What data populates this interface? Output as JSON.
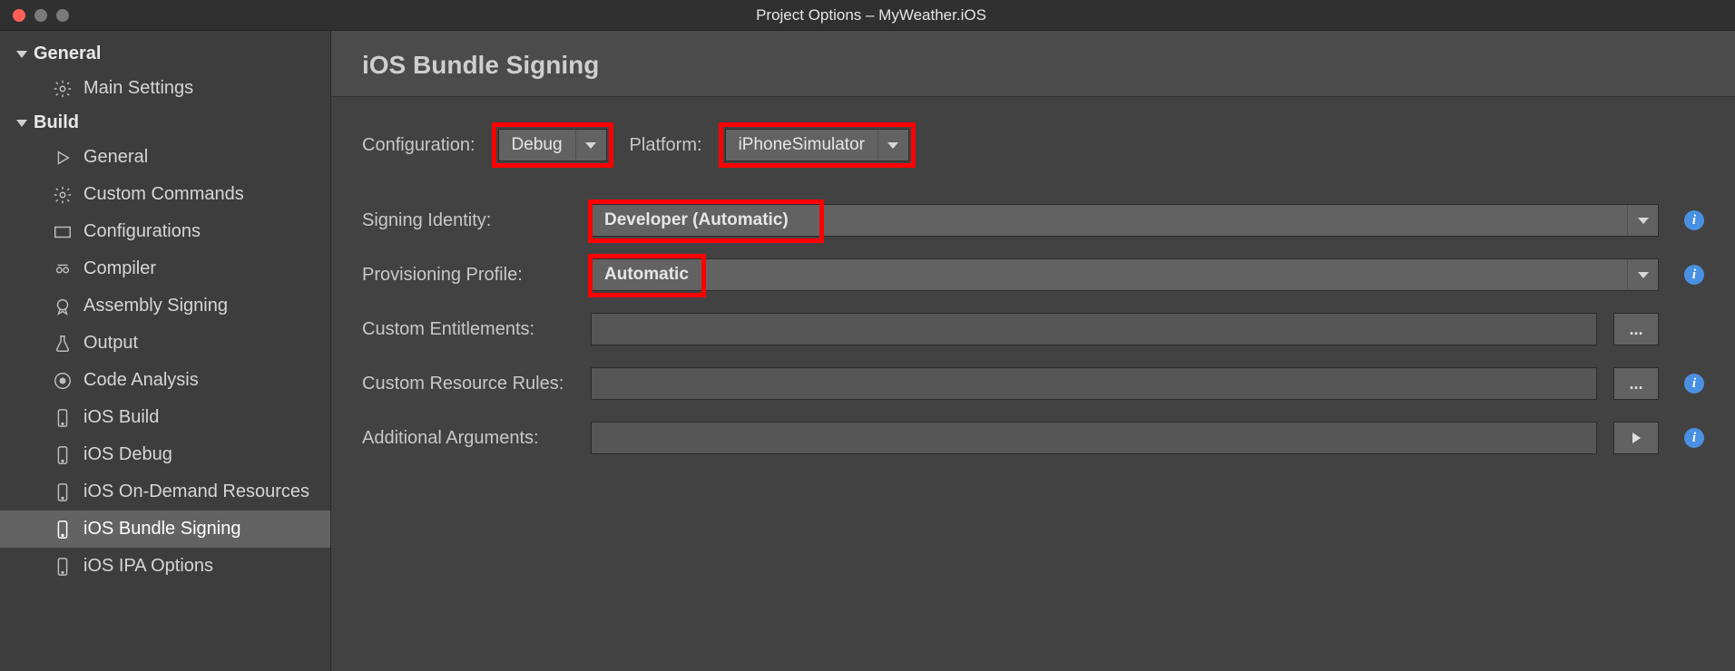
{
  "window": {
    "title": "Project Options – MyWeather.iOS"
  },
  "sidebar": {
    "categories": [
      {
        "label": "General",
        "items": [
          {
            "label": "Main Settings",
            "icon": "gear"
          }
        ]
      },
      {
        "label": "Build",
        "items": [
          {
            "label": "General",
            "icon": "play"
          },
          {
            "label": "Custom Commands",
            "icon": "gear"
          },
          {
            "label": "Configurations",
            "icon": "rect"
          },
          {
            "label": "Compiler",
            "icon": "compiler"
          },
          {
            "label": "Assembly Signing",
            "icon": "badge"
          },
          {
            "label": "Output",
            "icon": "flask"
          },
          {
            "label": "Code Analysis",
            "icon": "target"
          },
          {
            "label": "iOS Build",
            "icon": "phone"
          },
          {
            "label": "iOS Debug",
            "icon": "phone"
          },
          {
            "label": "iOS On-Demand Resources",
            "icon": "phone"
          },
          {
            "label": "iOS Bundle Signing",
            "icon": "phone",
            "selected": true
          },
          {
            "label": "iOS IPA Options",
            "icon": "phone"
          }
        ]
      }
    ]
  },
  "panel": {
    "title": "iOS Bundle Signing",
    "top": {
      "config_label": "Configuration:",
      "config_value": "Debug",
      "platform_label": "Platform:",
      "platform_value": "iPhoneSimulator"
    },
    "fields": {
      "signing_label": "Signing Identity:",
      "signing_value": "Developer (Automatic)",
      "provisioning_label": "Provisioning Profile:",
      "provisioning_value": "Automatic",
      "entitlements_label": "Custom Entitlements:",
      "entitlements_value": "",
      "resource_label": "Custom Resource Rules:",
      "resource_value": "",
      "args_label": "Additional Arguments:",
      "args_value": "",
      "browse": "...",
      "info": "i"
    }
  }
}
